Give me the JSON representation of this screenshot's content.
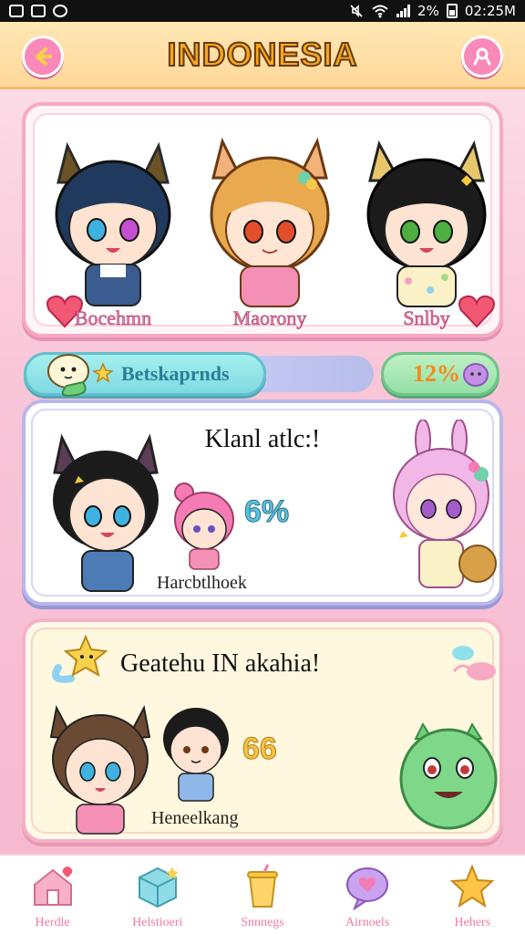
{
  "status_bar": {
    "left_icons": [
      "photo-icon",
      "nfc-icon",
      "cat-icon"
    ],
    "battery_text": "2%",
    "time": "02:25M"
  },
  "header": {
    "title": "INDONESIA",
    "back_icon": "arrow-left-icon",
    "profile_icon": "user-icon"
  },
  "hero": {
    "characters": [
      {
        "name": "Bocehmn",
        "hair": "#1f3a5c"
      },
      {
        "name": "Maorony",
        "hair": "#e9a94e"
      },
      {
        "name": "Snlby",
        "hair": "#1b1b1b"
      }
    ]
  },
  "tabs": {
    "left_label": "Betskaprnds",
    "right_label": "12%"
  },
  "battle": {
    "title": "Klanl atlc:!",
    "percent": "6%",
    "caption": "Harcbtlhoek"
  },
  "event": {
    "title": "Geatehu IN akahia!",
    "caption": "Heneelkang",
    "deco": "66"
  },
  "bottom_nav": {
    "items": [
      {
        "label": "Herdle",
        "icon": "house-icon",
        "color": "#f7b0c8"
      },
      {
        "label": "Helstioeri",
        "icon": "cube-icon",
        "color": "#8fdce7"
      },
      {
        "label": "Snnnegs",
        "icon": "cup-icon",
        "color": "#ffd46a"
      },
      {
        "label": "Airnoels",
        "icon": "heart-bubble-icon",
        "color": "#c9a3ef"
      },
      {
        "label": "Hehers",
        "icon": "star-icon",
        "color": "#ffc446"
      }
    ]
  },
  "colors": {
    "accent_pink": "#f889b9",
    "title_gold": "#f3a91c",
    "battle_border": "#b8b6ea"
  }
}
